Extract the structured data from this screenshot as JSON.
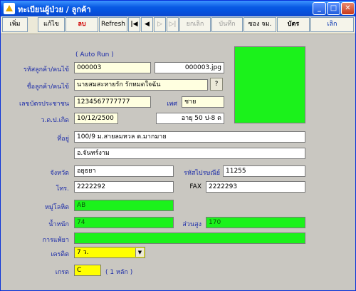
{
  "window": {
    "title": "ทะเบียนผู้ป่วย / ลูกค้า"
  },
  "toolbar": {
    "add": "เพิ่ม",
    "edit": "แก้ไข",
    "delete": "ลบ",
    "refresh": "Refresh",
    "first": "|◀",
    "prev": "◀",
    "next": "▷",
    "last": "▷|",
    "save": "ยกเลิก",
    "cancel": "บันทึก",
    "print_envelope": "ซอง จม.",
    "card": "บัตร",
    "exit": "เลิก"
  },
  "form": {
    "auto_run": "( Auto Run )",
    "code_label": "รหัสลูกค้า/คนไข้",
    "code": "000003",
    "photo_file": "000003.jpg",
    "name_label": "ชื่อลูกค้า/คนไข้",
    "name": "นายสมสะหายรัก รักหมดใจฉัน",
    "lookup": "?",
    "id_label": "เลขบัตรประชาชน",
    "id_number": "1234567777777",
    "sex_label": "เพศ",
    "sex": "ชาย",
    "dob_label": "ว.ด.ป.เกิด",
    "dob": "10/12/2500",
    "age": "อายุ 50 ป-8 ด",
    "address_label": "ที่อยู่",
    "address1": "100/9 ม.สายลมหวล ต.มากมาย",
    "address2": "อ.จันทร์งาม",
    "province_label": "จังหวัด",
    "province": "อยุธยา",
    "postcode_label": "รหัสไปรษณีย์",
    "postcode": "11255",
    "phone_label": "โทร.",
    "phone": "2222292",
    "fax_label": "FAX",
    "fax": "2222293",
    "blood_label": "หมู่โลหิต",
    "blood": "AB",
    "weight_label": "น้ำหนัก",
    "weight": "74",
    "height_label": "ส่วนสูง",
    "height": "170",
    "allergy_label": "การแพ้ยา",
    "allergy": "",
    "credit_label": "เครดิต",
    "credit": "7 ว.",
    "grade_label": "เกรด",
    "grade": "C",
    "grade_hint": "( 1 หลัก )"
  },
  "colors": {
    "accent_green": "#1bf21b",
    "field_yellow": "#ffff00",
    "label_blue": "#1a2aa8"
  }
}
